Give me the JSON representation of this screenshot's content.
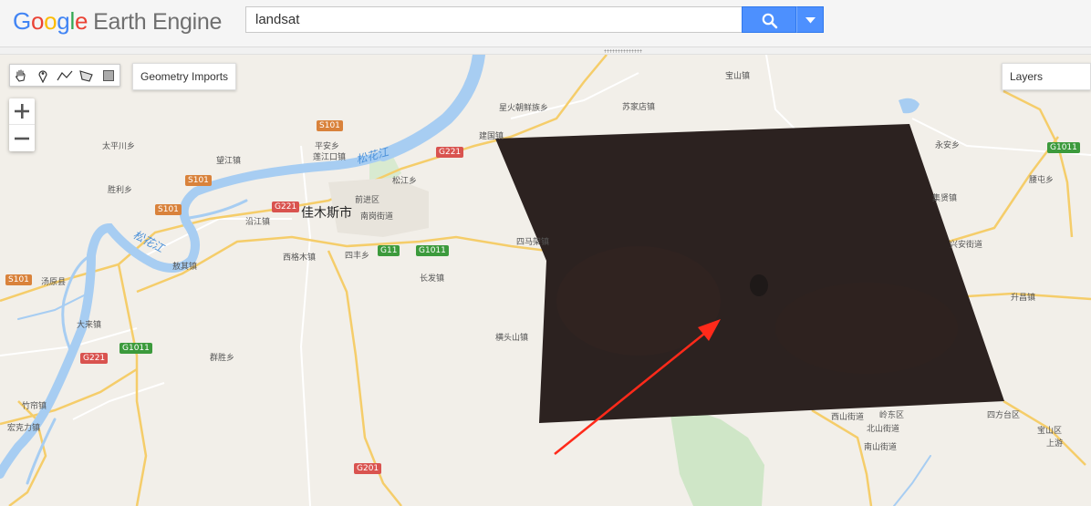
{
  "app": {
    "logo_letters": [
      {
        "ch": "G",
        "color": "#4285F4"
      },
      {
        "ch": "o",
        "color": "#EA4335"
      },
      {
        "ch": "o",
        "color": "#FBBC05"
      },
      {
        "ch": "g",
        "color": "#4285F4"
      },
      {
        "ch": "l",
        "color": "#34A853"
      },
      {
        "ch": "e",
        "color": "#EA4335"
      }
    ],
    "product": "Earth Engine"
  },
  "search": {
    "value": "landsat",
    "button_icon": "search-icon",
    "dropdown_icon": "caret-down-icon"
  },
  "map": {
    "geometry_tools": [
      "hand-icon",
      "point-marker-icon",
      "polyline-icon",
      "polygon-icon",
      "rectangle-icon"
    ],
    "geometry_imports_label": "Geometry Imports",
    "layers_label": "Layers",
    "zoom_in": "+",
    "zoom_out": "−",
    "overlay_color": "#2c2220",
    "arrow_color": "#ff2a1a",
    "city_label": "佳木斯市",
    "rivers": [
      "松花江",
      "松花江"
    ],
    "places": [
      "宝山镇",
      "星火朝鲜族乡",
      "苏家店镇",
      "建国镇",
      "太平川乡",
      "平安乡",
      "莲江口镇",
      "望江镇",
      "松江乡",
      "永安乡",
      "腰屯乡",
      "胜利乡",
      "前进区",
      "沿江镇",
      "南岗街道",
      "集贤镇",
      "四马架镇",
      "西格木镇",
      "四丰乡",
      "长发镇",
      "汤原县",
      "敖其镇",
      "兴安街道",
      "升昌镇",
      "大来镇",
      "横头山镇",
      "群胜乡",
      "竹帘镇",
      "宏克力镇",
      "西山街道",
      "岭东区",
      "北山街道",
      "南山街道",
      "四方台区",
      "宝山区",
      "上游"
    ],
    "road_shields": [
      "S101",
      "S101",
      "S101",
      "S101",
      "G221",
      "G221",
      "G221",
      "G11",
      "G1011",
      "G1011",
      "G1011",
      "G201"
    ]
  }
}
